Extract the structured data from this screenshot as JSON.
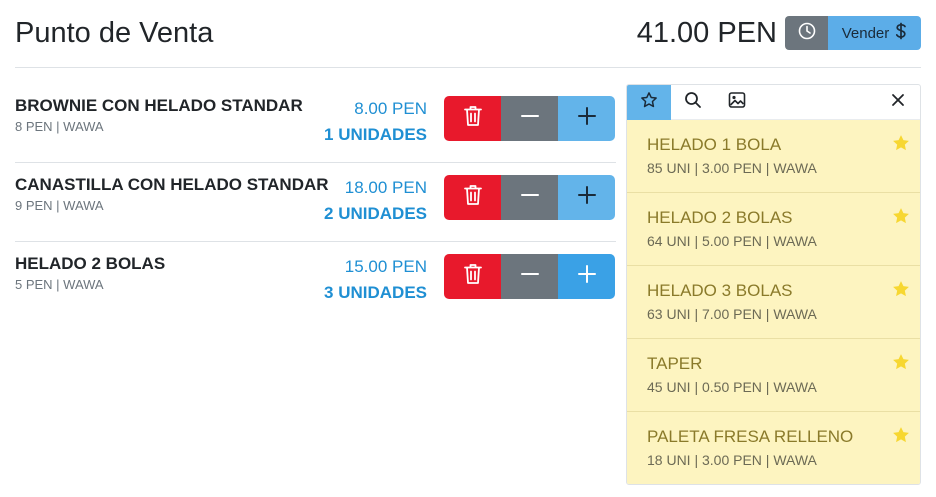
{
  "header": {
    "title": "Punto de Venta",
    "total": "41.00 PEN",
    "history_icon": "clock-icon",
    "sell_label": "Vender",
    "sell_icon": "dollar-icon"
  },
  "cart": {
    "items": [
      {
        "name": "BROWNIE CON HELADO STANDAR",
        "meta": "8 PEN | WAWA",
        "price": "8.00 PEN",
        "units": "1 UNIDADES"
      },
      {
        "name": "CANASTILLA CON HELADO STANDAR",
        "meta": "9 PEN | WAWA",
        "price": "18.00 PEN",
        "units": "2 UNIDADES"
      },
      {
        "name": "HELADO 2 BOLAS",
        "meta": "5 PEN | WAWA",
        "price": "15.00 PEN",
        "units": "3 UNIDADES"
      }
    ],
    "delete_icon": "trash-icon",
    "minus_icon": "minus-icon",
    "plus_icon": "plus-icon"
  },
  "panel": {
    "tabs": [
      "star-icon",
      "search-icon",
      "image-icon"
    ],
    "close_icon": "close-icon",
    "products": [
      {
        "name": "HELADO 1 BOLA",
        "meta": "85 UNI | 3.00 PEN | WAWA"
      },
      {
        "name": "HELADO 2 BOLAS",
        "meta": "64 UNI | 5.00 PEN | WAWA"
      },
      {
        "name": "HELADO 3 BOLAS",
        "meta": "63 UNI | 7.00 PEN | WAWA"
      },
      {
        "name": "TAPER",
        "meta": "45 UNI | 0.50 PEN | WAWA"
      },
      {
        "name": "PALETA FRESA RELLENO",
        "meta": "18 UNI | 3.00 PEN | WAWA"
      }
    ]
  },
  "colors": {
    "accent": "#63b4ea",
    "danger": "#e8192c",
    "secondary": "#6c757d",
    "price_text": "#1f8fd3",
    "product_bg": "#fdf4c0",
    "star": "#f7d731"
  }
}
